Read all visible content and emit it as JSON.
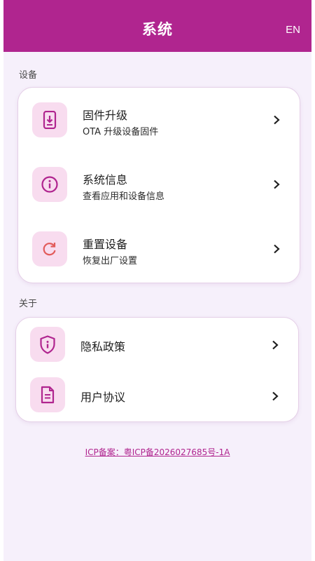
{
  "header": {
    "title": "系统",
    "lang_button": "EN"
  },
  "sections": {
    "device_label": "设备",
    "about_label": "关于"
  },
  "device_items": [
    {
      "title": "固件升级",
      "subtitle": "OTA 升级设备固件",
      "icon": "phone-download-icon"
    },
    {
      "title": "系统信息",
      "subtitle": "查看应用和设备信息",
      "icon": "info-circle-icon"
    },
    {
      "title": "重置设备",
      "subtitle": "恢复出厂设置",
      "icon": "reset-icon"
    }
  ],
  "about_items": [
    {
      "title": "隐私政策",
      "icon": "shield-info-icon"
    },
    {
      "title": "用户协议",
      "icon": "document-icon"
    }
  ],
  "footer": {
    "icp": "ICP备案：粤ICP备2026027685号-1A"
  },
  "colors": {
    "brand": "#b0258f",
    "background": "#f6f0fb",
    "icon_bg": "#f8dcef",
    "reset_icon": "#e25b5b"
  }
}
